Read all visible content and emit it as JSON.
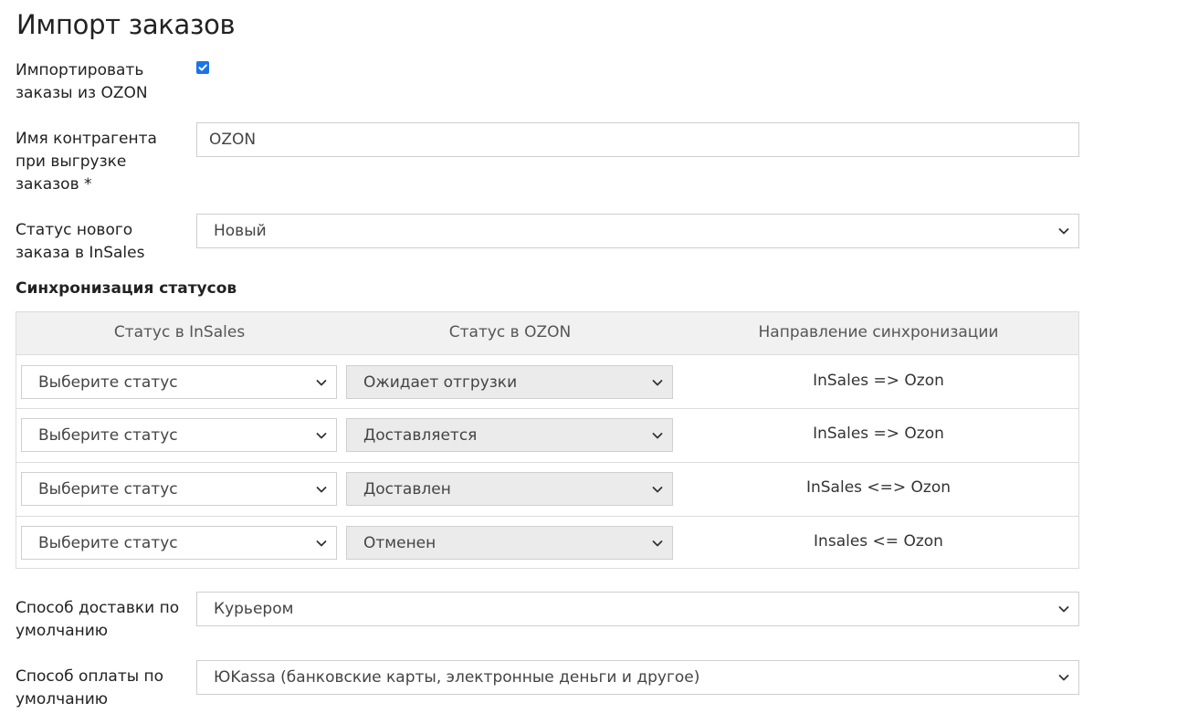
{
  "page": {
    "title": "Импорт заказов"
  },
  "import_orders": {
    "label": "Импортировать заказы из OZON",
    "checked": true
  },
  "counterparty": {
    "label": "Имя контрагента при выгрузке заказов *",
    "value": "OZON"
  },
  "new_order_status": {
    "label": "Статус нового заказа в InSales",
    "value": "Новый"
  },
  "status_sync": {
    "title": "Синхронизация статусов",
    "columns": [
      "Статус в InSales",
      "Статус в OZON",
      "Направление синхронизации"
    ],
    "rows": [
      {
        "insales": "Выберите статус",
        "ozon": "Ожидает отгрузки",
        "direction": "InSales => Ozon"
      },
      {
        "insales": "Выберите статус",
        "ozon": "Доставляется",
        "direction": "InSales => Ozon"
      },
      {
        "insales": "Выберите статус",
        "ozon": "Доставлен",
        "direction": "InSales <=> Ozon"
      },
      {
        "insales": "Выберите статус",
        "ozon": "Отменен",
        "direction": "Insales <= Ozon"
      }
    ]
  },
  "delivery": {
    "label": "Способ доставки по умолчанию",
    "value": "Курьером"
  },
  "payment": {
    "label": "Способ оплаты по умолчанию",
    "value": "ЮKassa (банковские карты, электронные деньги и другое)"
  },
  "colors": {
    "checkbox_accent": "#1a73e8",
    "table_header_bg": "#f1f1f1",
    "ozon_select_bg": "#ebebeb"
  }
}
